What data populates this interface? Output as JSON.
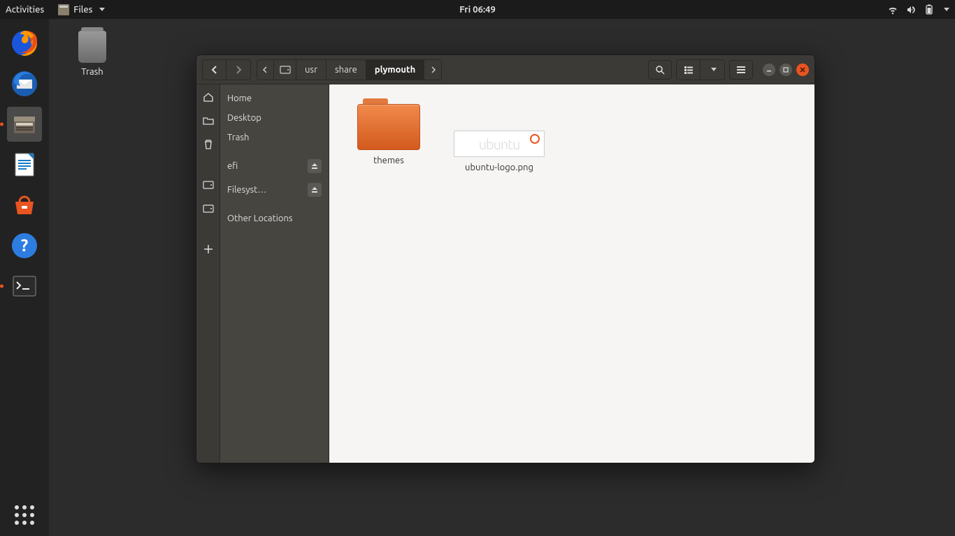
{
  "topbar": {
    "activities": "Activities",
    "files_menu": "Files",
    "clock": "Fri 06:49"
  },
  "desktop": {
    "trash_label": "Trash"
  },
  "dock": {
    "items": [
      "firefox",
      "thunderbird",
      "files",
      "libreoffice-writer",
      "software",
      "help",
      "terminal"
    ]
  },
  "window": {
    "path": {
      "root_icon": "disk",
      "seg1": "usr",
      "seg2": "share",
      "seg3": "plymouth"
    },
    "sidebar": {
      "home": "Home",
      "desktop": "Desktop",
      "trash": "Trash",
      "efi": "efi",
      "filesystem": "Filesyst…",
      "other": "Other Locations"
    },
    "content": {
      "items": [
        {
          "type": "folder",
          "label": "themes"
        },
        {
          "type": "image",
          "label": "ubuntu-logo.png",
          "thumb_text": "ubuntu"
        }
      ]
    }
  }
}
